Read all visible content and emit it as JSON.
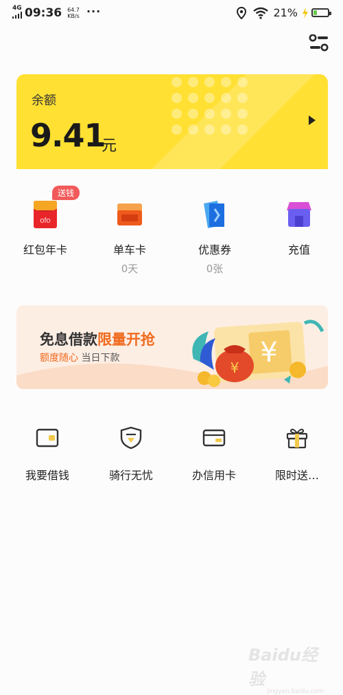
{
  "status_bar": {
    "network": "4G",
    "time": "09:36",
    "speed_value": "64.7",
    "speed_unit": "KB/s",
    "more": "···",
    "battery_percent": "21%",
    "battery_level": 0.21
  },
  "balance": {
    "label": "余额",
    "amount": "9.41",
    "unit": "元"
  },
  "quick_actions": [
    {
      "label": "红包年卡",
      "badge": "送钱",
      "icon": "red-envelope-icon",
      "sub": ""
    },
    {
      "label": "单车卡",
      "sub": "0天",
      "icon": "bike-card-icon"
    },
    {
      "label": "优惠券",
      "sub": "0张",
      "icon": "coupon-icon"
    },
    {
      "label": "充值",
      "sub": "",
      "icon": "store-icon"
    }
  ],
  "banner": {
    "title_prefix": "免息借款",
    "title_highlight": "限量开抢",
    "sub_highlight": "额度随心",
    "sub_rest": " 当日下款"
  },
  "services": [
    {
      "label": "我要借钱",
      "icon": "wallet-icon"
    },
    {
      "label": "骑行无忧",
      "icon": "shield-icon"
    },
    {
      "label": "办信用卡",
      "icon": "credit-card-icon"
    },
    {
      "label": "限时送…",
      "icon": "gift-icon"
    }
  ],
  "watermark": {
    "brand": "Baidu经验",
    "url": "jingyan.baidu.com"
  },
  "colors": {
    "accent_yellow": "#ffe033",
    "highlight_orange": "#f06a1e",
    "badge_red": "#f25a5a"
  }
}
